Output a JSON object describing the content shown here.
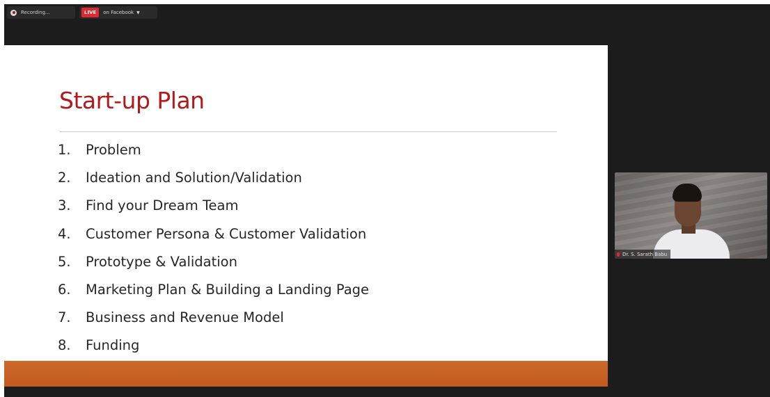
{
  "toolbar": {
    "recording_label": "Recording...",
    "live_badge": "LIVE",
    "live_destination": "on Facebook",
    "recording_icon": "record-icon",
    "dropdown_icon": "chevron-down-icon"
  },
  "slide": {
    "title": "Start-up Plan",
    "title_color": "#b3191b",
    "accent_band_color": "#c8622a",
    "items": [
      {
        "num": "1.",
        "text": "Problem"
      },
      {
        "num": "2.",
        "text": "Ideation and Solution/Validation"
      },
      {
        "num": "3.",
        "text": "Find your Dream Team"
      },
      {
        "num": "4.",
        "text": "Customer Persona & Customer Validation"
      },
      {
        "num": "5.",
        "text": "Prototype & Validation"
      },
      {
        "num": "6.",
        "text": "Marketing Plan & Building a Landing Page"
      },
      {
        "num": "7.",
        "text": "Business and Revenue Model"
      },
      {
        "num": "8.",
        "text": "Funding"
      }
    ]
  },
  "video": {
    "participant_name": "Dr. S. Sarath Babu"
  }
}
